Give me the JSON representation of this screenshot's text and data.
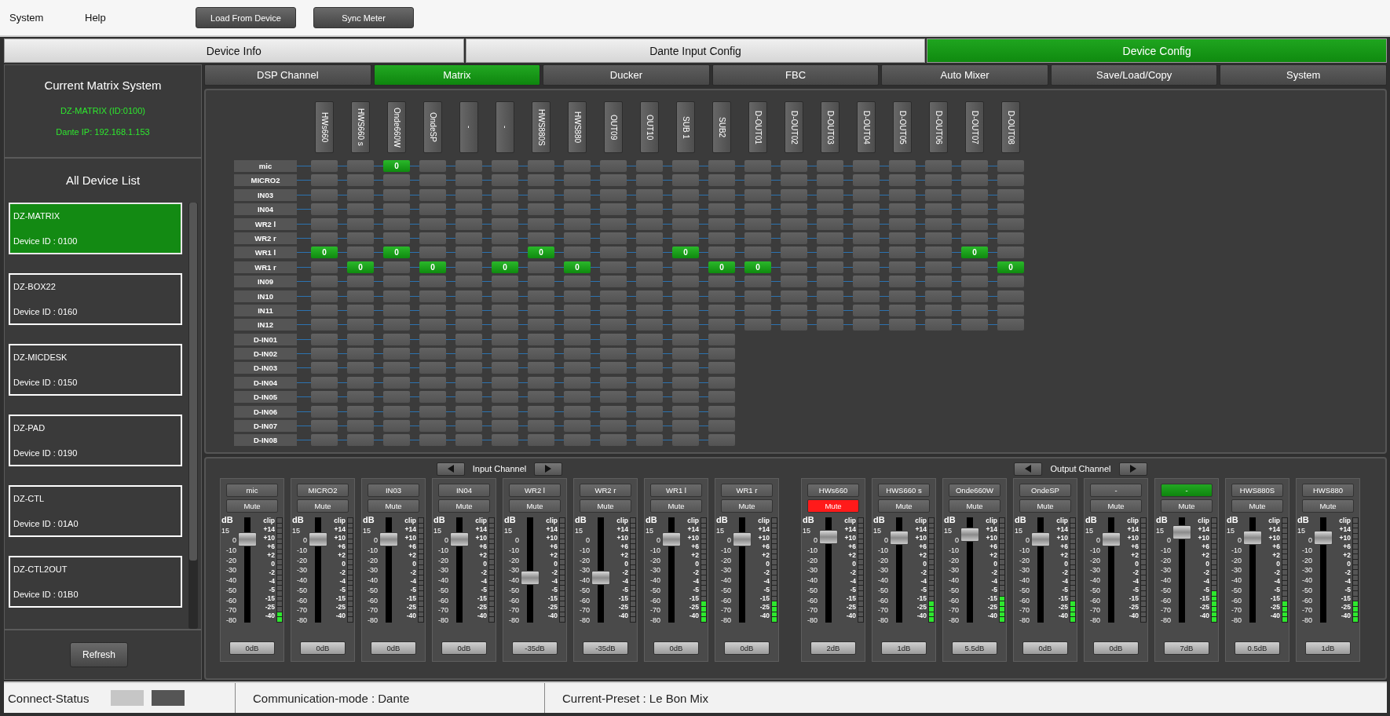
{
  "menu": [
    "System",
    "Help"
  ],
  "toolbar_buttons": [
    "Load From Device",
    "Sync Meter"
  ],
  "main_tabs": [
    {
      "label": "Device Info",
      "selected": false
    },
    {
      "label": "Dante Input Config",
      "selected": false
    },
    {
      "label": "Device Config",
      "selected": true
    }
  ],
  "sidebar": {
    "current_title": "Current Matrix System",
    "current_name": "DZ-MATRIX (ID:0100)",
    "current_ip": "Dante IP: 192.168.1.153",
    "list_title": "All Device List",
    "devices": [
      {
        "name": "DZ-MATRIX",
        "id": "Device ID :  0100",
        "selected": true
      },
      {
        "name": "DZ-BOX22",
        "id": "Device ID :  0160",
        "selected": false
      },
      {
        "name": "DZ-MICDESK",
        "id": "Device ID :  0150",
        "selected": false
      },
      {
        "name": "DZ-PAD",
        "id": "Device ID :  0190",
        "selected": false
      },
      {
        "name": "DZ-CTL",
        "id": "Device ID :  01A0",
        "selected": false
      },
      {
        "name": "DZ-CTL2OUT",
        "id": "Device ID :  01B0",
        "selected": false
      }
    ],
    "refresh_button": "Refresh"
  },
  "sub_tabs": [
    {
      "label": "DSP Channel",
      "selected": false
    },
    {
      "label": "Matrix",
      "selected": true
    },
    {
      "label": "Ducker",
      "selected": false
    },
    {
      "label": "FBC",
      "selected": false
    },
    {
      "label": "Auto Mixer",
      "selected": false
    },
    {
      "label": "Save/Load/Copy",
      "selected": false
    },
    {
      "label": "System",
      "selected": false
    }
  ],
  "matrix": {
    "columns": [
      "HWs660",
      "HWS660 s",
      "Onde660W",
      "OndeSP",
      "-",
      "-",
      "HWS880S",
      "HWS880",
      "OUT09",
      "OUT10",
      "SUB 1",
      "SUB2",
      "D-OUT01",
      "D-OUT02",
      "D-OUT03",
      "D-OUT04",
      "D-OUT05",
      "D-OUT06",
      "D-OUT07",
      "D-OUT08"
    ],
    "rows": [
      {
        "label": "mic",
        "cells": [
          {
            "on": false
          },
          {
            "on": false
          },
          {
            "on": true,
            "value": "0"
          },
          {
            "on": false
          },
          {
            "on": false
          },
          {
            "on": false
          },
          {
            "on": false
          },
          {
            "on": false
          },
          {
            "on": false
          },
          {
            "on": false
          },
          {
            "on": false
          },
          {
            "on": false
          },
          {
            "on": false
          },
          {
            "on": false
          },
          {
            "on": false
          },
          {
            "on": false
          },
          {
            "on": false
          },
          {
            "on": false
          },
          {
            "on": false
          },
          {
            "on": false
          }
        ]
      },
      {
        "label": "MICRO2",
        "cells": [
          {
            "on": false
          },
          {
            "on": false
          },
          {
            "on": false
          },
          {
            "on": false
          },
          {
            "on": false
          },
          {
            "on": false
          },
          {
            "on": false
          },
          {
            "on": false
          },
          {
            "on": false
          },
          {
            "on": false
          },
          {
            "on": false
          },
          {
            "on": false
          },
          {
            "on": false
          },
          {
            "on": false
          },
          {
            "on": false
          },
          {
            "on": false
          },
          {
            "on": false
          },
          {
            "on": false
          },
          {
            "on": false
          },
          {
            "on": false
          }
        ]
      },
      {
        "label": "IN03",
        "cells": [
          {
            "on": false
          },
          {
            "on": false
          },
          {
            "on": false
          },
          {
            "on": false
          },
          {
            "on": false
          },
          {
            "on": false
          },
          {
            "on": false
          },
          {
            "on": false
          },
          {
            "on": false
          },
          {
            "on": false
          },
          {
            "on": false
          },
          {
            "on": false
          },
          {
            "on": false
          },
          {
            "on": false
          },
          {
            "on": false
          },
          {
            "on": false
          },
          {
            "on": false
          },
          {
            "on": false
          },
          {
            "on": false
          },
          {
            "on": false
          }
        ]
      },
      {
        "label": "IN04",
        "cells": [
          {
            "on": false
          },
          {
            "on": false
          },
          {
            "on": false
          },
          {
            "on": false
          },
          {
            "on": false
          },
          {
            "on": false
          },
          {
            "on": false
          },
          {
            "on": false
          },
          {
            "on": false
          },
          {
            "on": false
          },
          {
            "on": false
          },
          {
            "on": false
          },
          {
            "on": false
          },
          {
            "on": false
          },
          {
            "on": false
          },
          {
            "on": false
          },
          {
            "on": false
          },
          {
            "on": false
          },
          {
            "on": false
          },
          {
            "on": false
          }
        ]
      },
      {
        "label": "WR2 l",
        "cells": [
          {
            "on": false
          },
          {
            "on": false
          },
          {
            "on": false
          },
          {
            "on": false
          },
          {
            "on": false
          },
          {
            "on": false
          },
          {
            "on": false
          },
          {
            "on": false
          },
          {
            "on": false
          },
          {
            "on": false
          },
          {
            "on": false
          },
          {
            "on": false
          },
          {
            "on": false
          },
          {
            "on": false
          },
          {
            "on": false
          },
          {
            "on": false
          },
          {
            "on": false
          },
          {
            "on": false
          },
          {
            "on": false
          },
          {
            "on": false
          }
        ]
      },
      {
        "label": "WR2 r",
        "cells": [
          {
            "on": false
          },
          {
            "on": false
          },
          {
            "on": false
          },
          {
            "on": false
          },
          {
            "on": false
          },
          {
            "on": false
          },
          {
            "on": false
          },
          {
            "on": false
          },
          {
            "on": false
          },
          {
            "on": false
          },
          {
            "on": false
          },
          {
            "on": false
          },
          {
            "on": false
          },
          {
            "on": false
          },
          {
            "on": false
          },
          {
            "on": false
          },
          {
            "on": false
          },
          {
            "on": false
          },
          {
            "on": false
          },
          {
            "on": false
          }
        ]
      },
      {
        "label": "WR1 l",
        "cells": [
          {
            "on": true,
            "value": "0"
          },
          {
            "on": false
          },
          {
            "on": true,
            "value": "0"
          },
          {
            "on": false
          },
          {
            "on": false
          },
          {
            "on": false
          },
          {
            "on": true,
            "value": "0"
          },
          {
            "on": false
          },
          {
            "on": false
          },
          {
            "on": false
          },
          {
            "on": true,
            "value": "0"
          },
          {
            "on": false
          },
          {
            "on": false
          },
          {
            "on": false
          },
          {
            "on": false
          },
          {
            "on": false
          },
          {
            "on": false
          },
          {
            "on": false
          },
          {
            "on": true,
            "value": "0"
          },
          {
            "on": false
          }
        ]
      },
      {
        "label": "WR1 r",
        "cells": [
          {
            "on": false
          },
          {
            "on": true,
            "value": "0"
          },
          {
            "on": false
          },
          {
            "on": true,
            "value": "0"
          },
          {
            "on": false
          },
          {
            "on": true,
            "value": "0"
          },
          {
            "on": false
          },
          {
            "on": true,
            "value": "0"
          },
          {
            "on": false
          },
          {
            "on": false
          },
          {
            "on": false
          },
          {
            "on": true,
            "value": "0"
          },
          {
            "on": true,
            "value": "0"
          },
          {
            "on": false
          },
          {
            "on": false
          },
          {
            "on": false
          },
          {
            "on": false
          },
          {
            "on": false
          },
          {
            "on": false
          },
          {
            "on": true,
            "value": "0"
          }
        ]
      },
      {
        "label": "IN09",
        "cells": [
          {
            "on": false
          },
          {
            "on": false
          },
          {
            "on": false
          },
          {
            "on": false
          },
          {
            "on": false
          },
          {
            "on": false
          },
          {
            "on": false
          },
          {
            "on": false
          },
          {
            "on": false
          },
          {
            "on": false
          },
          {
            "on": false
          },
          {
            "on": false
          },
          {
            "on": false
          },
          {
            "on": false
          },
          {
            "on": false
          },
          {
            "on": false
          },
          {
            "on": false
          },
          {
            "on": false
          },
          {
            "on": false
          },
          {
            "on": false
          }
        ]
      },
      {
        "label": "IN10",
        "cells": [
          {
            "on": false
          },
          {
            "on": false
          },
          {
            "on": false
          },
          {
            "on": false
          },
          {
            "on": false
          },
          {
            "on": false
          },
          {
            "on": false
          },
          {
            "on": false
          },
          {
            "on": false
          },
          {
            "on": false
          },
          {
            "on": false
          },
          {
            "on": false
          },
          {
            "on": false
          },
          {
            "on": false
          },
          {
            "on": false
          },
          {
            "on": false
          },
          {
            "on": false
          },
          {
            "on": false
          },
          {
            "on": false
          },
          {
            "on": false
          }
        ]
      },
      {
        "label": "IN11",
        "cells": [
          {
            "on": false
          },
          {
            "on": false
          },
          {
            "on": false
          },
          {
            "on": false
          },
          {
            "on": false
          },
          {
            "on": false
          },
          {
            "on": false
          },
          {
            "on": false
          },
          {
            "on": false
          },
          {
            "on": false
          },
          {
            "on": false
          },
          {
            "on": false
          },
          {
            "on": false
          },
          {
            "on": false
          },
          {
            "on": false
          },
          {
            "on": false
          },
          {
            "on": false
          },
          {
            "on": false
          },
          {
            "on": false
          },
          {
            "on": false
          }
        ]
      },
      {
        "label": "IN12",
        "cells": [
          {
            "on": false
          },
          {
            "on": false
          },
          {
            "on": false
          },
          {
            "on": false
          },
          {
            "on": false
          },
          {
            "on": false
          },
          {
            "on": false
          },
          {
            "on": false
          },
          {
            "on": false
          },
          {
            "on": false
          },
          {
            "on": false
          },
          {
            "on": false
          },
          {
            "on": false
          },
          {
            "on": false
          },
          {
            "on": false
          },
          {
            "on": false
          },
          {
            "on": false
          },
          {
            "on": false
          },
          {
            "on": false
          },
          {
            "on": false
          }
        ]
      },
      {
        "label": "D-IN01",
        "cells": [
          {
            "on": false
          },
          {
            "on": false
          },
          {
            "on": false
          },
          {
            "on": false
          },
          {
            "on": false
          },
          {
            "on": false
          },
          {
            "on": false
          },
          {
            "on": false
          },
          {
            "on": false
          },
          {
            "on": false
          },
          {
            "on": false
          },
          {
            "on": false
          }
        ]
      },
      {
        "label": "D-IN02",
        "cells": [
          {
            "on": false
          },
          {
            "on": false
          },
          {
            "on": false
          },
          {
            "on": false
          },
          {
            "on": false
          },
          {
            "on": false
          },
          {
            "on": false
          },
          {
            "on": false
          },
          {
            "on": false
          },
          {
            "on": false
          },
          {
            "on": false
          },
          {
            "on": false
          }
        ]
      },
      {
        "label": "D-IN03",
        "cells": [
          {
            "on": false
          },
          {
            "on": false
          },
          {
            "on": false
          },
          {
            "on": false
          },
          {
            "on": false
          },
          {
            "on": false
          },
          {
            "on": false
          },
          {
            "on": false
          },
          {
            "on": false
          },
          {
            "on": false
          },
          {
            "on": false
          },
          {
            "on": false
          }
        ]
      },
      {
        "label": "D-IN04",
        "cells": [
          {
            "on": false
          },
          {
            "on": false
          },
          {
            "on": false
          },
          {
            "on": false
          },
          {
            "on": false
          },
          {
            "on": false
          },
          {
            "on": false
          },
          {
            "on": false
          },
          {
            "on": false
          },
          {
            "on": false
          },
          {
            "on": false
          },
          {
            "on": false
          }
        ]
      },
      {
        "label": "D-IN05",
        "cells": [
          {
            "on": false
          },
          {
            "on": false
          },
          {
            "on": false
          },
          {
            "on": false
          },
          {
            "on": false
          },
          {
            "on": false
          },
          {
            "on": false
          },
          {
            "on": false
          },
          {
            "on": false
          },
          {
            "on": false
          },
          {
            "on": false
          },
          {
            "on": false
          }
        ]
      },
      {
        "label": "D-IN06",
        "cells": [
          {
            "on": false
          },
          {
            "on": false
          },
          {
            "on": false
          },
          {
            "on": false
          },
          {
            "on": false
          },
          {
            "on": false
          },
          {
            "on": false
          },
          {
            "on": false
          },
          {
            "on": false
          },
          {
            "on": false
          },
          {
            "on": false
          },
          {
            "on": false
          }
        ]
      },
      {
        "label": "D-IN07",
        "cells": [
          {
            "on": false
          },
          {
            "on": false
          },
          {
            "on": false
          },
          {
            "on": false
          },
          {
            "on": false
          },
          {
            "on": false
          },
          {
            "on": false
          },
          {
            "on": false
          },
          {
            "on": false
          },
          {
            "on": false
          },
          {
            "on": false
          },
          {
            "on": false
          }
        ]
      },
      {
        "label": "D-IN08",
        "cells": [
          {
            "on": false
          },
          {
            "on": false
          },
          {
            "on": false
          },
          {
            "on": false
          },
          {
            "on": false
          },
          {
            "on": false
          },
          {
            "on": false
          },
          {
            "on": false
          },
          {
            "on": false
          },
          {
            "on": false
          },
          {
            "on": false
          },
          {
            "on": false
          }
        ]
      }
    ]
  },
  "channel_groups": [
    {
      "title": "Input Channel",
      "strips": [
        {
          "name": "mic",
          "selected": false,
          "mute": "Mute",
          "muted": false,
          "fader": {
            "level": 0.84
          },
          "meter": {
            "level": 0.1
          },
          "gain": "0dB",
          "fader_scale": [
            "dB",
            "15",
            "0",
            "-10",
            "-20",
            "-30",
            "-40",
            "-50",
            "-60",
            "-70",
            "-80"
          ],
          "meter_scale": [
            "clip",
            "+14",
            "+10",
            "+6",
            "+2",
            "0",
            "-2",
            "-4",
            "-5",
            "-15",
            "-25",
            "-40"
          ]
        },
        {
          "name": "MICRO2",
          "selected": false,
          "mute": "Mute",
          "muted": false,
          "fader": {
            "level": 0.84
          },
          "meter": {
            "level": 0
          },
          "gain": "0dB",
          "fader_scale": [
            "dB",
            "15",
            "0",
            "-10",
            "-20",
            "-30",
            "-40",
            "-50",
            "-60",
            "-70",
            "-80"
          ],
          "meter_scale": [
            "clip",
            "+14",
            "+10",
            "+6",
            "+2",
            "0",
            "-2",
            "-4",
            "-5",
            "-15",
            "-25",
            "-40"
          ]
        },
        {
          "name": "IN03",
          "selected": false,
          "mute": "Mute",
          "muted": false,
          "fader": {
            "level": 0.84
          },
          "meter": {
            "level": 0
          },
          "gain": "0dB",
          "fader_scale": [
            "dB",
            "15",
            "0",
            "-10",
            "-20",
            "-30",
            "-40",
            "-50",
            "-60",
            "-70",
            "-80"
          ],
          "meter_scale": [
            "clip",
            "+14",
            "+10",
            "+6",
            "+2",
            "0",
            "-2",
            "-4",
            "-5",
            "-15",
            "-25",
            "-40"
          ]
        },
        {
          "name": "IN04",
          "selected": false,
          "mute": "Mute",
          "muted": false,
          "fader": {
            "level": 0.84
          },
          "meter": {
            "level": 0
          },
          "gain": "0dB",
          "fader_scale": [
            "dB",
            "15",
            "0",
            "-10",
            "-20",
            "-30",
            "-40",
            "-50",
            "-60",
            "-70",
            "-80"
          ],
          "meter_scale": [
            "clip",
            "+14",
            "+10",
            "+6",
            "+2",
            "0",
            "-2",
            "-4",
            "-5",
            "-15",
            "-25",
            "-40"
          ]
        },
        {
          "name": "WR2 l",
          "selected": false,
          "mute": "Mute",
          "muted": false,
          "fader": {
            "level": 0.41
          },
          "meter": {
            "level": 0
          },
          "gain": "-35dB",
          "fader_scale": [
            "dB",
            "15",
            "0",
            "-10",
            "-20",
            "-30",
            "-40",
            "-50",
            "-60",
            "-70",
            "-80"
          ],
          "meter_scale": [
            "clip",
            "+14",
            "+10",
            "+6",
            "+2",
            "0",
            "-2",
            "-4",
            "-5",
            "-15",
            "-25",
            "-40"
          ]
        },
        {
          "name": "WR2 r",
          "selected": false,
          "mute": "Mute",
          "muted": false,
          "fader": {
            "level": 0.41
          },
          "meter": {
            "level": 0
          },
          "gain": "-35dB",
          "fader_scale": [
            "dB",
            "15",
            "0",
            "-10",
            "-20",
            "-30",
            "-40",
            "-50",
            "-60",
            "-70",
            "-80"
          ],
          "meter_scale": [
            "clip",
            "+14",
            "+10",
            "+6",
            "+2",
            "0",
            "-2",
            "-4",
            "-5",
            "-15",
            "-25",
            "-40"
          ]
        },
        {
          "name": "WR1 l",
          "selected": false,
          "mute": "Mute",
          "muted": false,
          "fader": {
            "level": 0.84
          },
          "meter": {
            "level": 0.2
          },
          "gain": "0dB",
          "fader_scale": [
            "dB",
            "15",
            "0",
            "-10",
            "-20",
            "-30",
            "-40",
            "-50",
            "-60",
            "-70",
            "-80"
          ],
          "meter_scale": [
            "clip",
            "+14",
            "+10",
            "+6",
            "+2",
            "0",
            "-2",
            "-4",
            "-5",
            "-15",
            "-25",
            "-40"
          ]
        },
        {
          "name": "WR1 r",
          "selected": false,
          "mute": "Mute",
          "muted": false,
          "fader": {
            "level": 0.84
          },
          "meter": {
            "level": 0.2
          },
          "gain": "0dB",
          "fader_scale": [
            "dB",
            "15",
            "0",
            "-10",
            "-20",
            "-30",
            "-40",
            "-50",
            "-60",
            "-70",
            "-80"
          ],
          "meter_scale": [
            "clip",
            "+14",
            "+10",
            "+6",
            "+2",
            "0",
            "-2",
            "-4",
            "-5",
            "-15",
            "-25",
            "-40"
          ]
        }
      ]
    },
    {
      "title": "Output Channel",
      "strips": [
        {
          "name": "HWs660",
          "selected": false,
          "mute": "Mute",
          "muted": true,
          "fader": {
            "level": 0.86
          },
          "meter": {
            "level": 0
          },
          "gain": "2dB",
          "fader_scale": [
            "dB",
            "15",
            "0",
            "-10",
            "-20",
            "-30",
            "-40",
            "-50",
            "-60",
            "-70",
            "-80"
          ],
          "meter_scale": [
            "clip",
            "+14",
            "+10",
            "+6",
            "+2",
            "0",
            "-2",
            "-4",
            "-5",
            "-15",
            "-25",
            "-40"
          ]
        },
        {
          "name": "HWS660 s",
          "selected": false,
          "mute": "Mute",
          "muted": false,
          "fader": {
            "level": 0.85
          },
          "meter": {
            "level": 0.2
          },
          "gain": "1dB",
          "fader_scale": [
            "dB",
            "15",
            "0",
            "-10",
            "-20",
            "-30",
            "-40",
            "-50",
            "-60",
            "-70",
            "-80"
          ],
          "meter_scale": [
            "clip",
            "+14",
            "+10",
            "+6",
            "+2",
            "0",
            "-2",
            "-4",
            "-5",
            "-15",
            "-25",
            "-40"
          ]
        },
        {
          "name": "Onde660W",
          "selected": false,
          "mute": "Mute",
          "muted": false,
          "fader": {
            "level": 0.89
          },
          "meter": {
            "level": 0.25
          },
          "gain": "5.5dB",
          "fader_scale": [
            "dB",
            "15",
            "0",
            "-10",
            "-20",
            "-30",
            "-40",
            "-50",
            "-60",
            "-70",
            "-80"
          ],
          "meter_scale": [
            "clip",
            "+14",
            "+10",
            "+6",
            "+2",
            "0",
            "-2",
            "-4",
            "-5",
            "-15",
            "-25",
            "-40"
          ]
        },
        {
          "name": "OndeSP",
          "selected": false,
          "mute": "Mute",
          "muted": false,
          "fader": {
            "level": 0.84
          },
          "meter": {
            "level": 0.2
          },
          "gain": "0dB",
          "fader_scale": [
            "dB",
            "15",
            "0",
            "-10",
            "-20",
            "-30",
            "-40",
            "-50",
            "-60",
            "-70",
            "-80"
          ],
          "meter_scale": [
            "clip",
            "+14",
            "+10",
            "+6",
            "+2",
            "0",
            "-2",
            "-4",
            "-5",
            "-15",
            "-25",
            "-40"
          ]
        },
        {
          "name": "-",
          "selected": false,
          "mute": "Mute",
          "muted": false,
          "fader": {
            "level": 0.84
          },
          "meter": {
            "level": 0
          },
          "gain": "0dB",
          "fader_scale": [
            "dB",
            "15",
            "0",
            "-10",
            "-20",
            "-30",
            "-40",
            "-50",
            "-60",
            "-70",
            "-80"
          ],
          "meter_scale": [
            "clip",
            "+14",
            "+10",
            "+6",
            "+2",
            "0",
            "-2",
            "-4",
            "-5",
            "-15",
            "-25",
            "-40"
          ]
        },
        {
          "name": "-",
          "selected": true,
          "mute": "Mute",
          "muted": false,
          "fader": {
            "level": 0.91
          },
          "meter": {
            "level": 0.3
          },
          "gain": "7dB",
          "fader_scale": [
            "dB",
            "15",
            "0",
            "-10",
            "-20",
            "-30",
            "-40",
            "-50",
            "-60",
            "-70",
            "-80"
          ],
          "meter_scale": [
            "clip",
            "+14",
            "+10",
            "+6",
            "+2",
            "0",
            "-2",
            "-4",
            "-5",
            "-15",
            "-25",
            "-40"
          ]
        },
        {
          "name": "HWS880S",
          "selected": false,
          "mute": "Mute",
          "muted": false,
          "fader": {
            "level": 0.85
          },
          "meter": {
            "level": 0.2
          },
          "gain": "0.5dB",
          "fader_scale": [
            "dB",
            "15",
            "0",
            "-10",
            "-20",
            "-30",
            "-40",
            "-50",
            "-60",
            "-70",
            "-80"
          ],
          "meter_scale": [
            "clip",
            "+14",
            "+10",
            "+6",
            "+2",
            "0",
            "-2",
            "-4",
            "-5",
            "-15",
            "-25",
            "-40"
          ]
        },
        {
          "name": "HWS880",
          "selected": false,
          "mute": "Mute",
          "muted": false,
          "fader": {
            "level": 0.85
          },
          "meter": {
            "level": 0.2
          },
          "gain": "1dB",
          "fader_scale": [
            "dB",
            "15",
            "0",
            "-10",
            "-20",
            "-30",
            "-40",
            "-50",
            "-60",
            "-70",
            "-80"
          ],
          "meter_scale": [
            "clip",
            "+14",
            "+10",
            "+6",
            "+2",
            "0",
            "-2",
            "-4",
            "-5",
            "-15",
            "-25",
            "-40"
          ]
        }
      ]
    }
  ],
  "status_bar": {
    "connect_label": "Connect-Status",
    "communication": "Communication-mode : Dante",
    "preset": "Current-Preset : Le Bon Mix"
  }
}
